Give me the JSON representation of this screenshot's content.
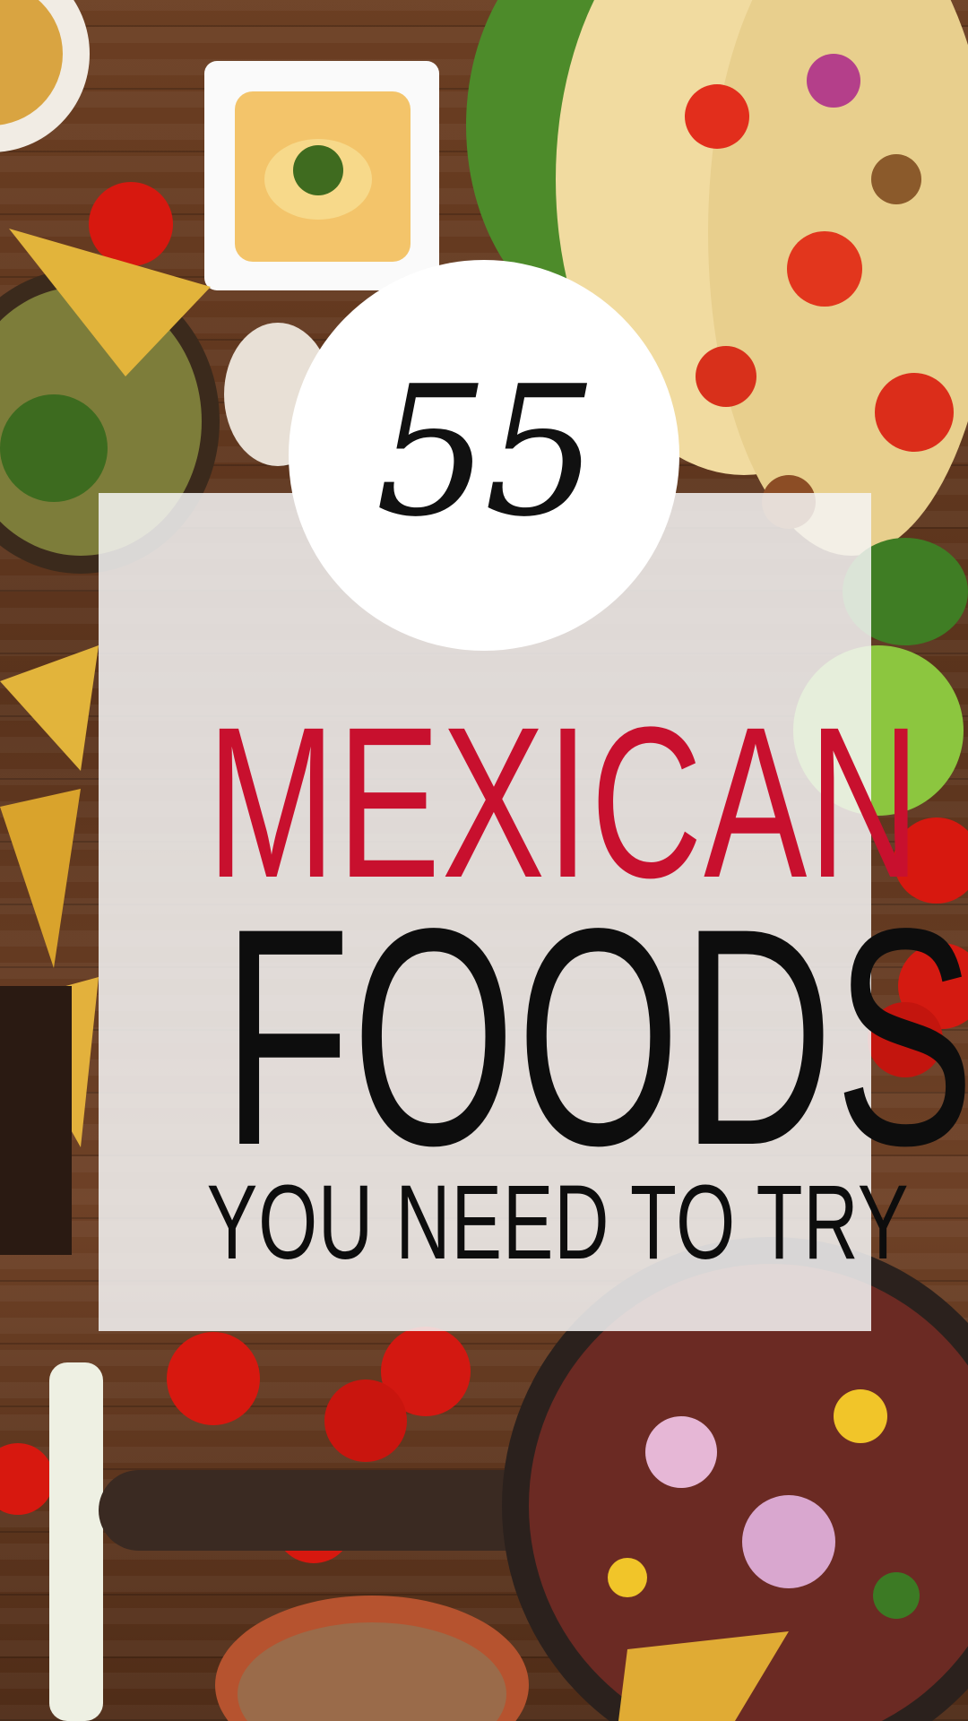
{
  "badge": {
    "number": "55"
  },
  "headline": {
    "line1": "MEXICAN",
    "line2": "FOODS",
    "line3": "YOU NEED TO TRY"
  },
  "colors": {
    "accent_red": "#c8102e",
    "text_dark": "#0d0d0d",
    "card_bg": "#f5f5f5",
    "badge_bg": "#ffffff"
  }
}
